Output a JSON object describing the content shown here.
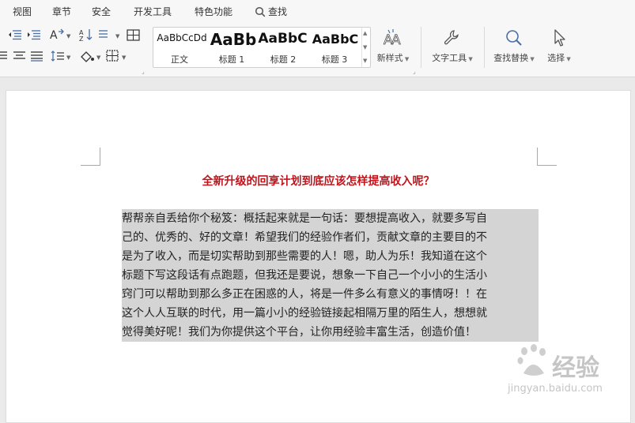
{
  "menu": {
    "items": [
      "视图",
      "章节",
      "安全",
      "开发工具",
      "特色功能"
    ],
    "search_label": "查找"
  },
  "styles": {
    "gallery": [
      {
        "sample": "AaBbCcDd",
        "name": "正文"
      },
      {
        "sample": "AaBb",
        "name": "标题 1"
      },
      {
        "sample": "AaBbC",
        "name": "标题 2"
      },
      {
        "sample": "AaBbC",
        "name": "标题 3"
      }
    ],
    "new_style_label": "新样式"
  },
  "tools": {
    "text_tools_label": "文字工具",
    "find_replace_label": "查找替换",
    "select_label": "选择"
  },
  "document": {
    "title": "全新升级的回享计划到底应该怎样提高收入呢？",
    "lines": [
      "帮帮亲自丢给你个秘笈：概括起来就是一句话：要想提高收入，就要多写自",
      "己的、优秀的、好的文章！希望我们的经验作者们，贡献文章的主要目的不",
      "是为了收入，而是切实帮助到那些需要的人！嗯，助人为乐！我知道在这个",
      "标题下写这段话有点跑题，但我还是要说，想象一下自己一个小小的生活小",
      "窍门可以帮助到那么多正在困惑的人，将是一件多么有意义的事情呀！！在",
      "这个人人互联的时代，用一篇小小的经验链接起相隔万里的陌生人，想想就",
      "觉得美好呢！我们为你提供这个平台，让你用经验丰富生活，创造价值！"
    ]
  },
  "watermark": {
    "brand": "经验",
    "url": "jingyan.baidu.com"
  }
}
